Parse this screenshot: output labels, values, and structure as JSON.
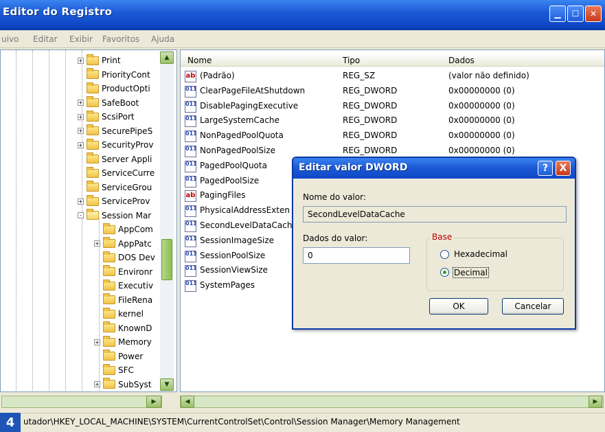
{
  "window": {
    "title": "Editor do Registro"
  },
  "menu": [
    "uivo",
    "Editar",
    "Exibir",
    "Favoritos",
    "Ajuda"
  ],
  "tree": [
    {
      "label": "Print",
      "exp": "+",
      "level": 1
    },
    {
      "label": "PriorityCont",
      "exp": "",
      "level": 1
    },
    {
      "label": "ProductOpti",
      "exp": "",
      "level": 1
    },
    {
      "label": "SafeBoot",
      "exp": "+",
      "level": 1
    },
    {
      "label": "ScsiPort",
      "exp": "+",
      "level": 1
    },
    {
      "label": "SecurePipeS",
      "exp": "+",
      "level": 1
    },
    {
      "label": "SecurityProv",
      "exp": "+",
      "level": 1
    },
    {
      "label": "Server Appli",
      "exp": "",
      "level": 1
    },
    {
      "label": "ServiceCurre",
      "exp": "",
      "level": 1
    },
    {
      "label": "ServiceGrou",
      "exp": "",
      "level": 1
    },
    {
      "label": "ServiceProv",
      "exp": "+",
      "level": 1
    },
    {
      "label": "Session Mar",
      "exp": "-",
      "level": 1
    },
    {
      "label": "AppCom",
      "exp": "",
      "level": 2
    },
    {
      "label": "AppPatc",
      "exp": "+",
      "level": 2
    },
    {
      "label": "DOS Dev",
      "exp": "",
      "level": 2
    },
    {
      "label": "Environr",
      "exp": "",
      "level": 2
    },
    {
      "label": "Executiv",
      "exp": "",
      "level": 2
    },
    {
      "label": "FileRena",
      "exp": "",
      "level": 2
    },
    {
      "label": "kernel",
      "exp": "",
      "level": 2
    },
    {
      "label": "KnownD",
      "exp": "",
      "level": 2
    },
    {
      "label": "Memory",
      "exp": "+",
      "level": 2
    },
    {
      "label": "Power",
      "exp": "",
      "level": 2
    },
    {
      "label": "SFC",
      "exp": "",
      "level": 2
    },
    {
      "label": "SubSyst",
      "exp": "+",
      "level": 2
    }
  ],
  "list": {
    "headers": [
      "Nome",
      "Tipo",
      "Dados"
    ],
    "rows": [
      {
        "icon": "ab",
        "name": "(Padrão)",
        "type": "REG_SZ",
        "data": "(valor não definido)"
      },
      {
        "icon": "bin",
        "name": "ClearPageFileAtShutdown",
        "type": "REG_DWORD",
        "data": "0x00000000 (0)"
      },
      {
        "icon": "bin",
        "name": "DisablePagingExecutive",
        "type": "REG_DWORD",
        "data": "0x00000000 (0)"
      },
      {
        "icon": "bin",
        "name": "LargeSystemCache",
        "type": "REG_DWORD",
        "data": "0x00000000 (0)"
      },
      {
        "icon": "bin",
        "name": "NonPagedPoolQuota",
        "type": "REG_DWORD",
        "data": "0x00000000 (0)"
      },
      {
        "icon": "bin",
        "name": "NonPagedPoolSize",
        "type": "REG_DWORD",
        "data": "0x00000000 (0)"
      },
      {
        "icon": "bin",
        "name": "PagedPoolQuota",
        "type": "",
        "data": ""
      },
      {
        "icon": "bin",
        "name": "PagedPoolSize",
        "type": "",
        "data": ""
      },
      {
        "icon": "ab",
        "name": "PagingFiles",
        "type": "",
        "data": ""
      },
      {
        "icon": "bin",
        "name": "PhysicalAddressExten",
        "type": "",
        "data": ""
      },
      {
        "icon": "bin",
        "name": "SecondLevelDataCach",
        "type": "",
        "data": ""
      },
      {
        "icon": "bin",
        "name": "SessionImageSize",
        "type": "",
        "data": ""
      },
      {
        "icon": "bin",
        "name": "SessionPoolSize",
        "type": "",
        "data": ""
      },
      {
        "icon": "bin",
        "name": "SessionViewSize",
        "type": "",
        "data": ""
      },
      {
        "icon": "bin",
        "name": "SystemPages",
        "type": "",
        "data": ""
      }
    ]
  },
  "dialog": {
    "title": "Editar valor DWORD",
    "help_label": "?",
    "close_label": "X",
    "name_label": "Nome do valor:",
    "name_value": "SecondLevelDataCache",
    "data_label": "Dados do valor:",
    "data_value": "0",
    "base_label": "Base",
    "hex_label": "Hexadecimal",
    "dec_label": "Decimal",
    "ok_label": "OK",
    "cancel_label": "Cancelar"
  },
  "status": {
    "badge": "4",
    "path": "utador\\HKEY_LOCAL_MACHINE\\SYSTEM\\CurrentControlSet\\Control\\Session Manager\\Memory Management"
  }
}
